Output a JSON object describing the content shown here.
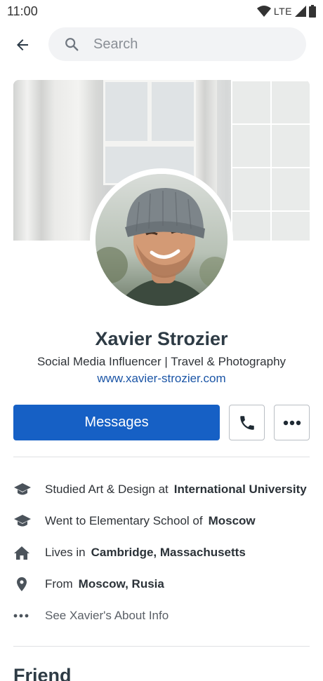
{
  "status_bar": {
    "time": "11:00",
    "network": "LTE"
  },
  "top_bar": {
    "search_placeholder": "Search"
  },
  "profile": {
    "name": "Xavier Strozier",
    "tagline": "Social Media Influencer | Travel & Photography",
    "website": "www.xavier-strozier.com"
  },
  "actions": {
    "messages_label": "Messages"
  },
  "about": {
    "items": [
      {
        "icon": "graduation-cap-icon",
        "text": "Studied Art & Design at",
        "strong": "International University"
      },
      {
        "icon": "graduation-cap-icon",
        "text": "Went to Elementary School of",
        "strong": "Moscow"
      },
      {
        "icon": "home-icon",
        "text": "Lives in",
        "strong": "Cambridge, Massachusetts"
      },
      {
        "icon": "location-pin-icon",
        "text": "From",
        "strong": "Moscow, Rusia"
      },
      {
        "icon": "more-horizontal-icon",
        "text": "See Xavier's About Info",
        "strong": ""
      }
    ]
  },
  "sections": {
    "friends_title": "Friend"
  },
  "colors": {
    "primary": "#1660c5",
    "link": "#1b55a6",
    "text_dark": "#2e3b45"
  }
}
